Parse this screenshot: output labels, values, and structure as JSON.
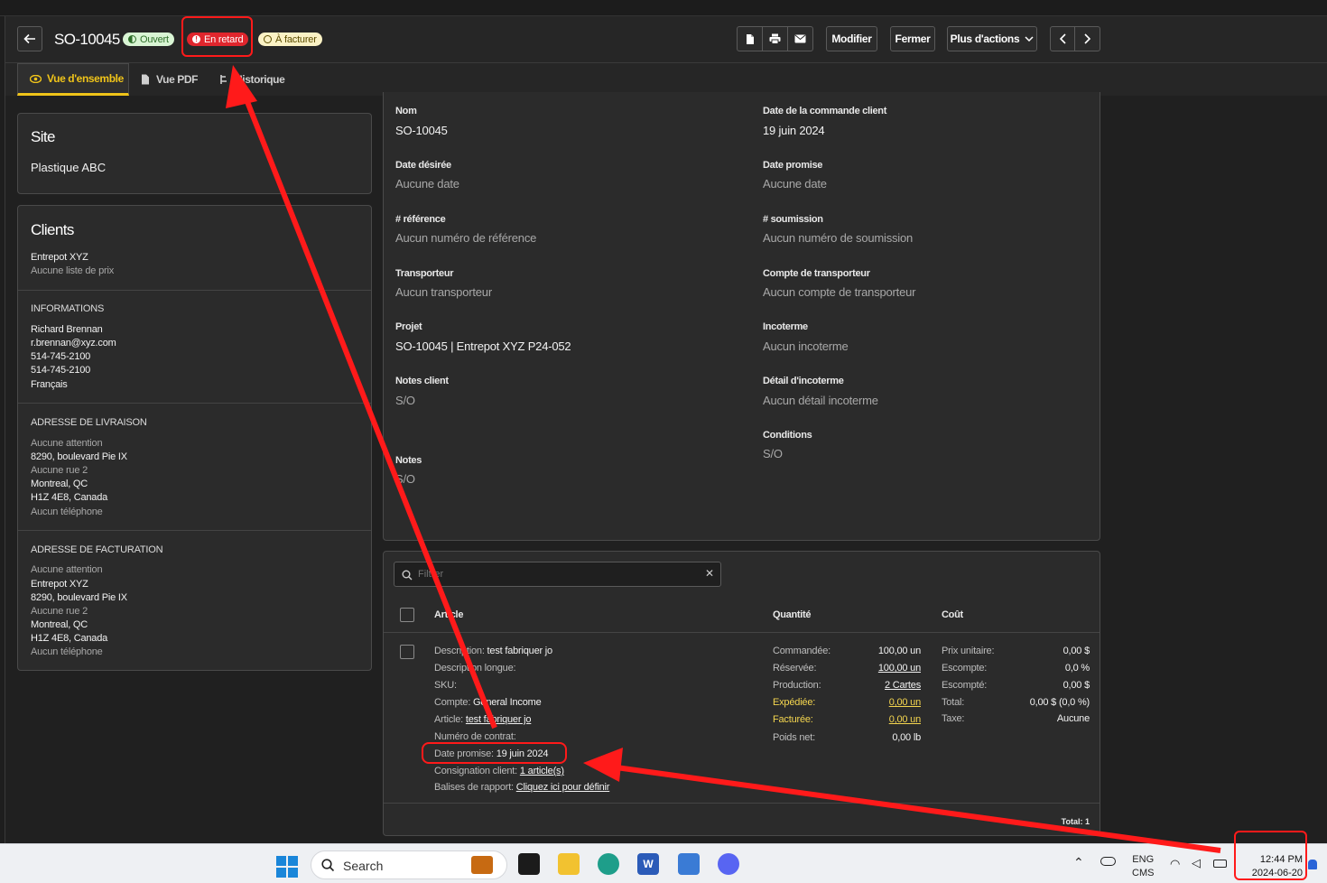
{
  "header": {
    "order_number": "SO-10045",
    "badges": {
      "open": "Ouvert",
      "late": "En retard",
      "to_bill": "À facturer"
    },
    "buttons": {
      "edit": "Modifier",
      "close": "Fermer",
      "more_actions": "Plus d'actions"
    }
  },
  "tabs": {
    "overview": "Vue d'ensemble",
    "pdf_view": "Vue PDF",
    "history": "Historique"
  },
  "site": {
    "title": "Site",
    "value": "Plastique ABC"
  },
  "clients": {
    "title": "Clients",
    "name": "Entrepot XYZ",
    "price_list": "Aucune liste de prix",
    "info_title": "INFORMATIONS",
    "contact_name": "Richard Brennan",
    "email": "r.brennan@xyz.com",
    "phone1": "514-745-2100",
    "phone2": "514-745-2100",
    "language": "Français",
    "delivery_title": "ADRESSE DE LIVRAISON",
    "delivery": {
      "attention": "Aucune attention",
      "street": "8290, boulevard Pie IX",
      "street2": "Aucune rue 2",
      "city": "Montreal, QC",
      "postal": "H1Z 4E8, Canada",
      "phone": "Aucun téléphone"
    },
    "billing_title": "ADRESSE DE FACTURATION",
    "billing": {
      "attention": "Aucune attention",
      "company": "Entrepot XYZ",
      "street": "8290, boulevard Pie IX",
      "street2": "Aucune rue 2",
      "city": "Montreal, QC",
      "postal": "H1Z 4E8, Canada",
      "phone": "Aucun téléphone"
    }
  },
  "details": {
    "name_label": "Nom",
    "name_value": "SO-10045",
    "order_date_label": "Date de la commande client",
    "order_date_value": "19 juin 2024",
    "desired_date_label": "Date désirée",
    "desired_date_value": "Aucune date",
    "promised_date_label": "Date promise",
    "promised_date_value": "Aucune date",
    "reference_label": "# référence",
    "reference_value": "Aucun numéro de référence",
    "submission_label": "# soumission",
    "submission_value": "Aucun numéro de soumission",
    "carrier_label": "Transporteur",
    "carrier_value": "Aucun transporteur",
    "carrier_account_label": "Compte de transporteur",
    "carrier_account_value": "Aucun compte de transporteur",
    "project_label": "Projet",
    "project_value": "SO-10045 | Entrepot XYZ P24-052",
    "incoterm_label": "Incoterme",
    "incoterm_value": "Aucun incoterme",
    "client_notes_label": "Notes client",
    "client_notes_value": "S/O",
    "incoterm_detail_label": "Détail d'incoterme",
    "incoterm_detail_value": "Aucun détail incoterme",
    "conditions_label": "Conditions",
    "conditions_value": "S/O",
    "notes_label": "Notes",
    "notes_value": "S/O"
  },
  "items": {
    "filter_placeholder": "Filtrer",
    "col_article": "Article",
    "col_quantity": "Quantité",
    "col_cost": "Coût",
    "row": {
      "description_label": "Description:",
      "description_value": "test fabriquer jo",
      "long_description_label": "Description longue:",
      "sku_label": "SKU:",
      "account_label": "Compte:",
      "account_value": "General Income",
      "article_label": "Article:",
      "article_value": "test fabriquer jo",
      "contract_label": "Numéro de contrat:",
      "promised_label": "Date promise:",
      "promised_value": "19 juin 2024",
      "consignment_label": "Consignation client:",
      "consignment_value": "1 article(s)",
      "tags_label": "Balises de rapport:",
      "tags_value": "Cliquez ici pour définir",
      "ordered_label": "Commandée:",
      "ordered_value": "100,00 un",
      "reserved_label": "Réservée:",
      "reserved_value": "100,00 un",
      "production_label": "Production:",
      "production_value": "2 Cartes",
      "shipped_label": "Expédiée:",
      "shipped_value": "0,00 un",
      "billed_label": "Facturée:",
      "billed_value": "0,00 un",
      "net_weight_label": "Poids net:",
      "net_weight_value": "0,00 lb",
      "unit_price_label": "Prix unitaire:",
      "unit_price_value": "0,00 $",
      "discount_label": "Escompte:",
      "discount_value": "0,0 %",
      "discounted_label": "Escompté:",
      "discounted_value": "0,00 $",
      "total_label": "Total:",
      "total_value": "0,00 $ (0,0 %)",
      "tax_label": "Taxe:",
      "tax_value": "Aucune"
    },
    "footer_total": "Total: 1"
  },
  "taskbar": {
    "search_label": "Search",
    "lang": "ENG",
    "lang_sub": "CMS",
    "time": "12:44 PM",
    "date": "2024-06-20"
  },
  "colors": {
    "accent": "#f0c419",
    "late": "#e0262d",
    "annotation": "#ff1a1a"
  }
}
